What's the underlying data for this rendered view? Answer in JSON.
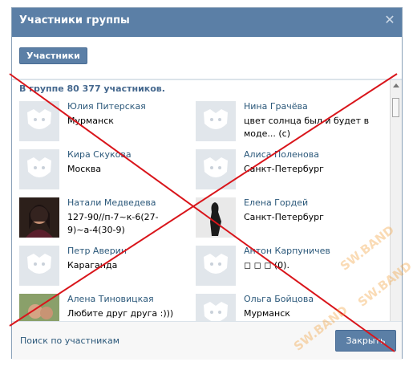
{
  "dialog": {
    "title": "Участники группы",
    "close_icon": "close-icon",
    "tab_label": "Участники",
    "count_text": "В группе 80 377 участников.",
    "members": [
      {
        "name": "Юлия Питерская",
        "info": "Мурманск"
      },
      {
        "name": "Нина Грачёва",
        "info": "цвет солнца был и будет в моде... (c)"
      },
      {
        "name": "Кира Скукова",
        "info": "Москва"
      },
      {
        "name": "Алиса Поленова",
        "info": "Санкт-Петербург"
      },
      {
        "name": "Натали Медведева",
        "info": "127-90//п-7~к-6(27-9)~а-4(30-9)"
      },
      {
        "name": "Елена Гордей",
        "info": "Санкт-Петербург"
      },
      {
        "name": "Петр Аверин",
        "info": "Караганда"
      },
      {
        "name": "Антон Карпуничев",
        "info": "◻ ◻ ◻ (0)."
      },
      {
        "name": "Алена Тиновицкая",
        "info": "Любите друг друга :)))"
      },
      {
        "name": "Ольга Бойцова",
        "info": "Мурманск"
      }
    ],
    "footer": {
      "search_link": "Поиск по участникам",
      "close_button": "Закрыть"
    }
  },
  "overlay": {
    "watermark_text": "SW.BAND",
    "cross_color": "#d9151b"
  }
}
